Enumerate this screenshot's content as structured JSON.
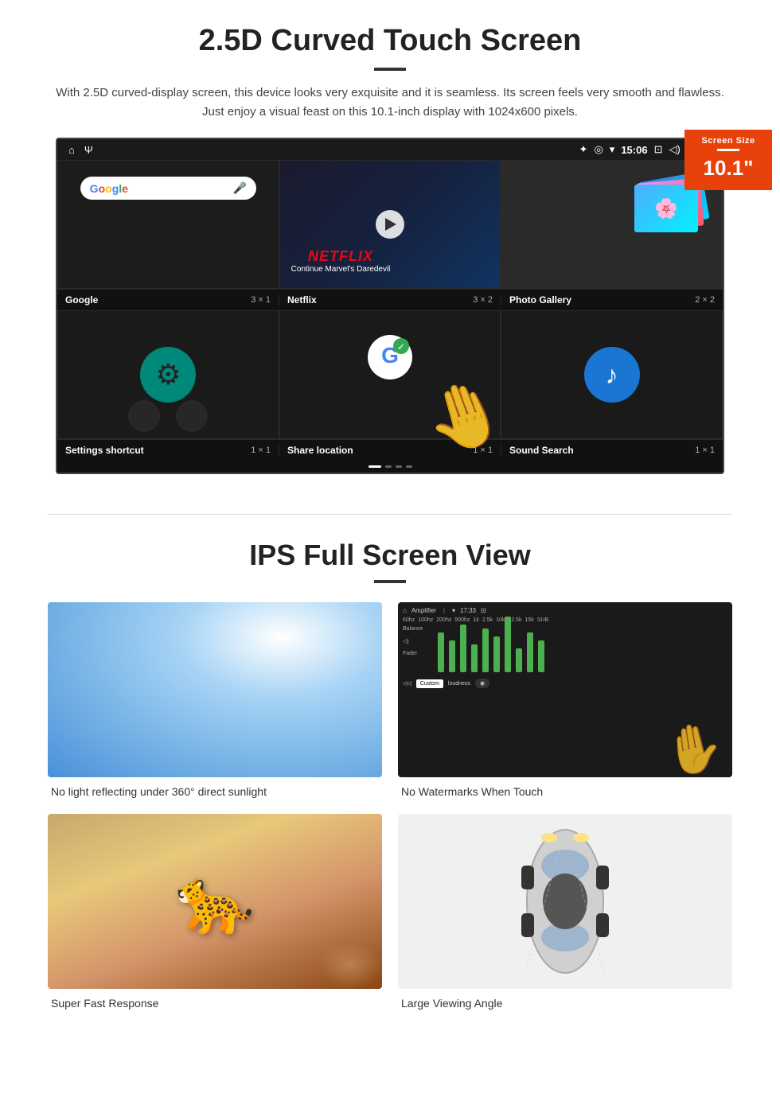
{
  "section1": {
    "title": "2.5D Curved Touch Screen",
    "description": "With 2.5D curved-display screen, this device looks very exquisite and it is seamless. Its screen feels very smooth and flawless. Just enjoy a visual feast on this 10.1-inch display with 1024x600 pixels.",
    "badge": {
      "label": "Screen Size",
      "size": "10.1\""
    },
    "statusBar": {
      "bluetooth": "✦",
      "location": "◎",
      "wifi": "▼",
      "time": "15:06",
      "camera": "⊡",
      "volume": "◁)",
      "close": "⊠",
      "window": "▭"
    },
    "apps": [
      {
        "name": "Google",
        "size": "3 × 1",
        "searchPlaceholder": "Google",
        "micIcon": "🎤"
      },
      {
        "name": "Netflix",
        "size": "3 × 2",
        "netflixText": "NETFLIX",
        "netflixSub": "Continue Marvel's Daredevil"
      },
      {
        "name": "Photo Gallery",
        "size": "2 × 2"
      },
      {
        "name": "Settings shortcut",
        "size": "1 × 1"
      },
      {
        "name": "Share location",
        "size": "1 × 1"
      },
      {
        "name": "Sound Search",
        "size": "1 × 1"
      }
    ]
  },
  "section2": {
    "title": "IPS Full Screen View",
    "features": [
      {
        "id": "sunlight",
        "caption": "No light reflecting under 360° direct sunlight"
      },
      {
        "id": "amplifier",
        "caption": "No Watermarks When Touch"
      },
      {
        "id": "cheetah",
        "caption": "Super Fast Response"
      },
      {
        "id": "car",
        "caption": "Large Viewing Angle"
      }
    ],
    "ampLabels": {
      "balance": "Balance",
      "fader": "Fader",
      "title": "Amplifier",
      "custom": "Custom",
      "loudness": "loudness",
      "frequencies": [
        "60hz",
        "100hz",
        "200hz",
        "500hz",
        "1k",
        "2.5k",
        "10k",
        "12.5k",
        "15k",
        "SUB"
      ]
    }
  }
}
